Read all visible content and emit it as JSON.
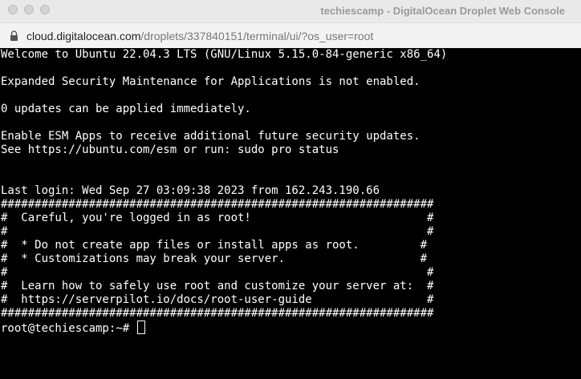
{
  "window": {
    "title": "techiescamp - DigitalOcean Droplet Web Console"
  },
  "urlbar": {
    "host": "cloud.digitalocean.com",
    "path": "/droplets/337840151/terminal/ui/?os_user=root"
  },
  "terminal": {
    "lines": [
      "Welcome to Ubuntu 22.04.3 LTS (GNU/Linux 5.15.0-84-generic x86_64)",
      "",
      "Expanded Security Maintenance for Applications is not enabled.",
      "",
      "0 updates can be applied immediately.",
      "",
      "Enable ESM Apps to receive additional future security updates.",
      "See https://ubuntu.com/esm or run: sudo pro status",
      "",
      "",
      "Last login: Wed Sep 27 03:09:38 2023 from 162.243.190.66",
      "################################################################",
      "#  Careful, you're logged in as root!                          #",
      "#                                                              #",
      "#  * Do not create app files or install apps as root.         #",
      "#  * Customizations may break your server.                    #",
      "#                                                              #",
      "#  Learn how to safely use root and customize your server at:  #",
      "#  https://serverpilot.io/docs/root-user-guide                 #",
      "################################################################"
    ],
    "prompt": "root@techiescamp:~# "
  }
}
